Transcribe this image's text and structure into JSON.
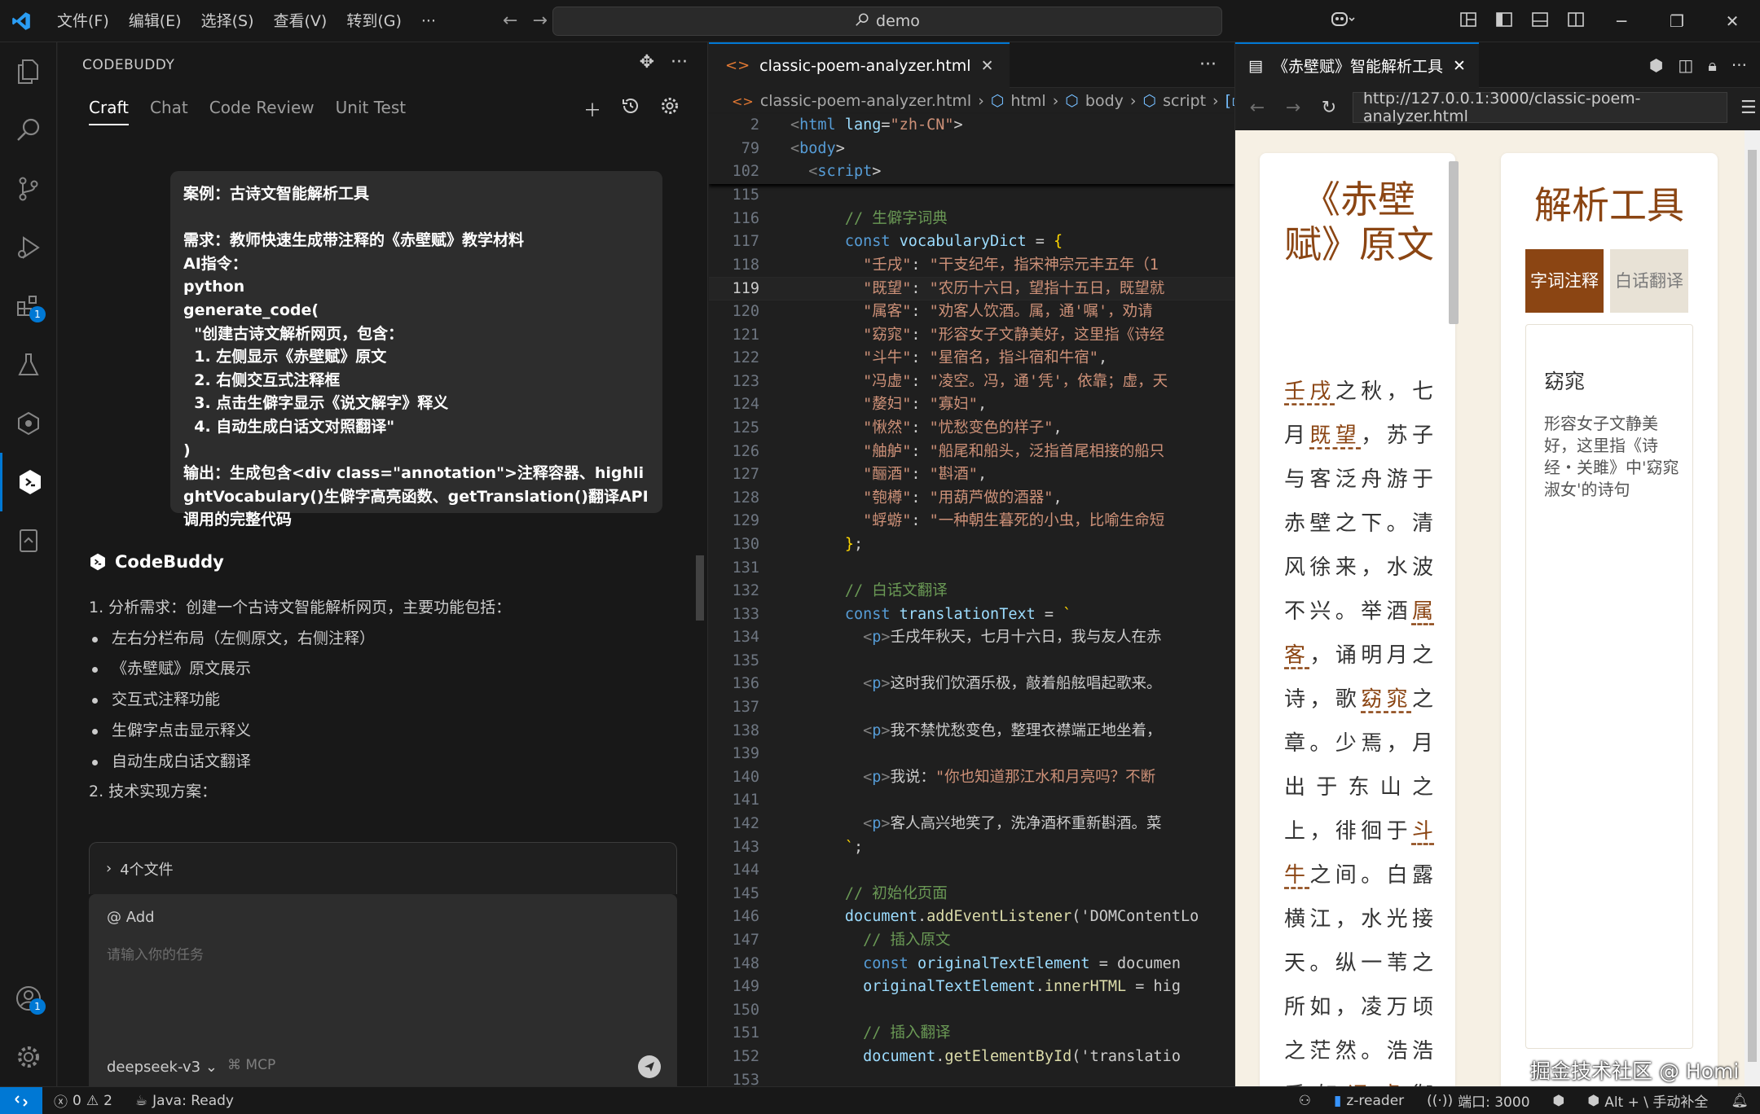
{
  "titlebar": {
    "menu": [
      "文件(F)",
      "编辑(E)",
      "选择(S)",
      "查看(V)",
      "转到(G)",
      "···"
    ],
    "search": "demo"
  },
  "sidepanel": {
    "title": "CODEBUDDY",
    "tabs": [
      "Craft",
      "Chat",
      "Code Review",
      "Unit Test"
    ],
    "user_message": "案例：古诗文智能解析工具\n\n需求：教师快速生成带注释的《赤壁赋》教学材料\nAI指令：\npython\ngenerate_code(\n  \"创建古诗文解析网页，包含：\n  1. 左侧显示《赤壁赋》原文\n  2. 右侧交互式注释框\n  3. 点击生僻字显示《说文解字》释义\n  4. 自动生成白话文对照翻译\"\n)\n输出：生成包含<div class=\"annotation\">注释容器、highlightVocabulary()生僻字高亮函数、getTranslation()翻译API调用的完整代码",
    "assistant_name": "CodeBuddy",
    "reply": {
      "p1": "1. 分析需求：创建一个古诗文智能解析网页，主要功能包括：",
      "bullets": [
        "左右分栏布局（左侧原文，右侧注释）",
        "《赤壁赋》原文展示",
        "交互式注释功能",
        "生僻字点击显示释义",
        "自动生成白话文翻译"
      ],
      "p2": "2. 技术实现方案："
    },
    "files_label": "4个文件",
    "composer": {
      "add": "@ Add",
      "placeholder": "请输入你的任务",
      "model": "deepseek-v3",
      "mcp": "MCP"
    }
  },
  "editor": {
    "tab": "classic-poem-analyzer.html",
    "breadcrumbs": [
      "classic-poem-analyzer.html",
      "html",
      "body",
      "script",
      "vo"
    ],
    "sticky": [
      {
        "n": "2",
        "t": "<html lang=\"zh-CN\">"
      },
      {
        "n": "79",
        "t": "<body>"
      },
      {
        "n": "102",
        "t": "  <script>"
      }
    ],
    "lines": [
      {
        "n": "115",
        "t": ""
      },
      {
        "n": "116",
        "t": "      // 生僻字词典"
      },
      {
        "n": "117",
        "t": "      const vocabularyDict = {"
      },
      {
        "n": "118",
        "t": "        \"壬戌\": \"干支纪年，指宋神宗元丰五年（1"
      },
      {
        "n": "119",
        "t": "        \"既望\": \"农历十六日，望指十五日，既望就"
      },
      {
        "n": "120",
        "t": "        \"属客\": \"劝客人饮酒。属，通'嘱'，劝请"
      },
      {
        "n": "121",
        "t": "        \"窈窕\": \"形容女子文静美好，这里指《诗经"
      },
      {
        "n": "122",
        "t": "        \"斗牛\": \"星宿名，指斗宿和牛宿\","
      },
      {
        "n": "123",
        "t": "        \"冯虚\": \"凌空。冯，通'凭'，依靠；虚，天"
      },
      {
        "n": "124",
        "t": "        \"嫠妇\": \"寡妇\","
      },
      {
        "n": "125",
        "t": "        \"愀然\": \"忧愁变色的样子\","
      },
      {
        "n": "126",
        "t": "        \"舳舻\": \"船尾和船头，泛指首尾相接的船只"
      },
      {
        "n": "127",
        "t": "        \"酾酒\": \"斟酒\","
      },
      {
        "n": "128",
        "t": "        \"匏樽\": \"用葫芦做的酒器\","
      },
      {
        "n": "129",
        "t": "        \"蜉蝣\": \"一种朝生暮死的小虫，比喻生命短"
      },
      {
        "n": "130",
        "t": "      };"
      },
      {
        "n": "131",
        "t": ""
      },
      {
        "n": "132",
        "t": "      // 白话文翻译"
      },
      {
        "n": "133",
        "t": "      const translationText = `"
      },
      {
        "n": "134",
        "t": "        <p>壬戌年秋天，七月十六日，我与友人在赤"
      },
      {
        "n": "135",
        "t": ""
      },
      {
        "n": "136",
        "t": "        <p>这时我们饮酒乐极，敲着船舷唱起歌来。"
      },
      {
        "n": "137",
        "t": ""
      },
      {
        "n": "138",
        "t": "        <p>我不禁忧愁变色，整理衣襟端正地坐着，"
      },
      {
        "n": "139",
        "t": ""
      },
      {
        "n": "140",
        "t": "        <p>我说：\"你也知道那江水和月亮吗？不断"
      },
      {
        "n": "141",
        "t": ""
      },
      {
        "n": "142",
        "t": "        <p>客人高兴地笑了，洗净酒杯重新斟酒。菜"
      },
      {
        "n": "143",
        "t": "      `;"
      },
      {
        "n": "144",
        "t": ""
      },
      {
        "n": "145",
        "t": "      // 初始化页面"
      },
      {
        "n": "146",
        "t": "      document.addEventListener('DOMContentLo"
      },
      {
        "n": "147",
        "t": "        // 插入原文"
      },
      {
        "n": "148",
        "t": "        const originalTextElement = documen"
      },
      {
        "n": "149",
        "t": "        originalTextElement.innerHTML = hig"
      },
      {
        "n": "150",
        "t": ""
      },
      {
        "n": "151",
        "t": "        // 插入翻译"
      },
      {
        "n": "152",
        "t": "        document.getElementById('translatio"
      },
      {
        "n": "153",
        "t": ""
      }
    ],
    "current_line": "119"
  },
  "browser": {
    "tab": "《赤壁赋》智能解析工具",
    "url": "http://127.0.0.1:3000/classic-poem-analyzer.html",
    "poem_title": "《赤壁赋》原文",
    "poem": [
      {
        "t": "壬戌",
        "v": true
      },
      {
        "t": "之秋，七月"
      },
      {
        "t": "既望",
        "v": true
      },
      {
        "t": "，苏子与客泛舟游于赤壁之下。清风徐来，水波不兴。举酒"
      },
      {
        "t": "属客",
        "v": true
      },
      {
        "t": "，诵明月之诗，歌"
      },
      {
        "t": "窈窕",
        "v": true
      },
      {
        "t": "之章。少焉，月出于东山之上，徘徊于"
      },
      {
        "t": "斗牛",
        "v": true
      },
      {
        "t": "之间。白露横江，水光接天。纵一苇之所如，凌万顷之茫然。浩浩乎如"
      },
      {
        "t": "冯虚",
        "v": true
      },
      {
        "t": "御"
      }
    ],
    "tool_title": "解析工具",
    "tool_tabs": [
      "字词注释",
      "白话翻译"
    ],
    "annotation_word": "窈窕",
    "annotation_text": "形容女子文静美好，这里指《诗经・关雎》中'窈窕淑女'的诗句",
    "watermark": "掘金技术社区 @ Homi"
  },
  "statusbar": {
    "errors": "0",
    "warnings": "2",
    "java": "Java: Ready",
    "branch": "z-reader",
    "port": "端口: 3000",
    "shortcut": "Alt + \\ 手动补全"
  }
}
